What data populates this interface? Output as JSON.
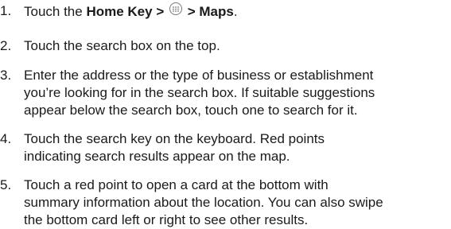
{
  "steps": [
    {
      "number": "1.",
      "parts": {
        "prefix": "Touch the ",
        "home_key": "Home Key >",
        "icon": "apps-grid-icon",
        "maps": "> Maps",
        "suffix": "."
      }
    },
    {
      "number": "2.",
      "text": "Touch the search box on the top."
    },
    {
      "number": "3.",
      "text": "Enter the address or the type of business or establishment\nyou’re looking for in the search box. If suitable suggestions\nappear below the search box, touch one to search for it."
    },
    {
      "number": "4.",
      "text": "Touch the search key on the keyboard. Red points\nindicating search results appear on the map."
    },
    {
      "number": "5.",
      "text": "Touch a red point to open a card at the bottom with\nsummary information about the location. You can also swipe\nthe bottom card left or right to see other results."
    }
  ]
}
